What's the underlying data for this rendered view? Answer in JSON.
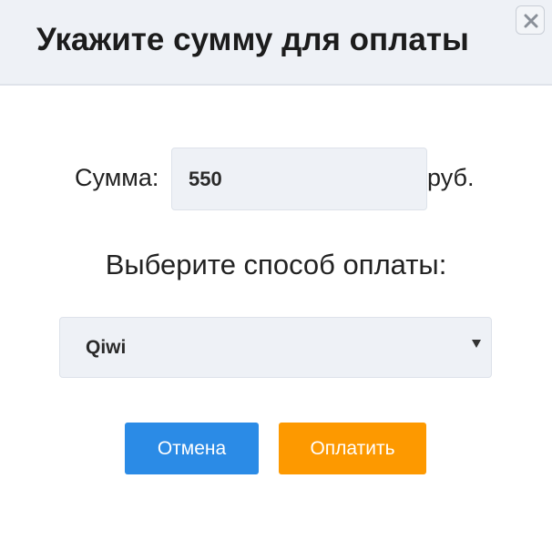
{
  "dialog": {
    "title": "Укажите сумму для оплаты",
    "close_icon": "close-icon"
  },
  "amount": {
    "label": "Сумма:",
    "value": "550",
    "unit": "руб."
  },
  "payment_method": {
    "heading": "Выберите способ оплаты:",
    "selected": "Qiwi",
    "dropdown_icon": "dropdown-arrow-icon"
  },
  "buttons": {
    "cancel_label": "Отмена",
    "pay_label": "Оплатить"
  },
  "colors": {
    "header_bg": "#eef1f6",
    "cancel_button": "#2b8be6",
    "pay_button": "#fd9900",
    "input_bg": "#eef1f6"
  }
}
